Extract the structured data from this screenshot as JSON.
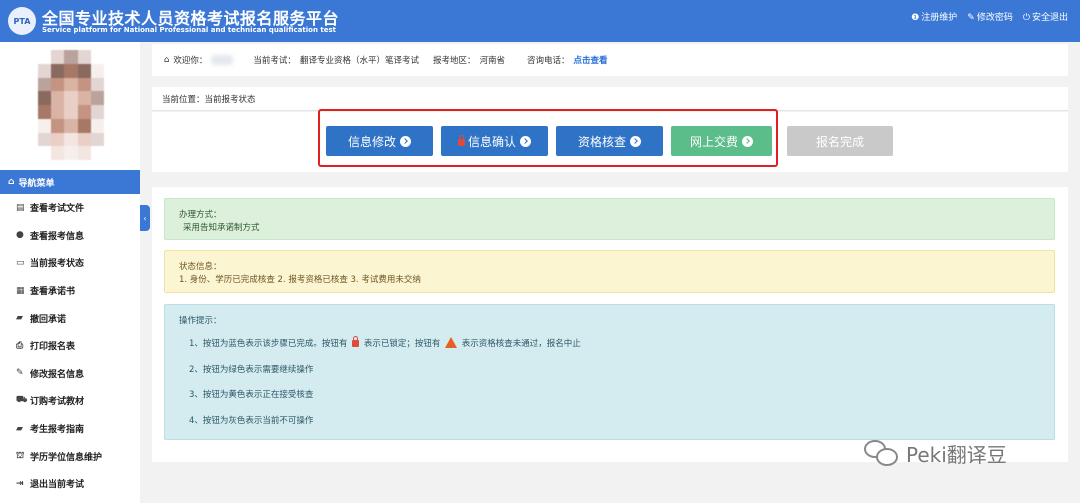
{
  "colors": {
    "header": "#3b78d6",
    "step_blue": "#2f73c6",
    "step_green": "#5bbd8a",
    "step_grey": "#c9c9c9",
    "highlight": "#e02020"
  },
  "header": {
    "title_cn": "全国专业技术人员资格考试报名服务平台",
    "title_en": "Service platform for National Professional and technican qualification test",
    "logo_text": "PTA",
    "links": [
      {
        "icon": "info-icon",
        "label": "注册维护"
      },
      {
        "icon": "edit-icon",
        "label": "修改密码"
      },
      {
        "icon": "power-icon",
        "label": "安全退出"
      }
    ]
  },
  "sidebar": {
    "nav_title": "导航菜单",
    "items": [
      {
        "icon": "document-icon",
        "label": "查看考试文件"
      },
      {
        "icon": "info-icon",
        "label": "查看报考信息"
      },
      {
        "icon": "monitor-icon",
        "label": "当前报考状态"
      },
      {
        "icon": "card-icon",
        "label": "查看承诺书"
      },
      {
        "icon": "book-icon",
        "label": "撤回承诺"
      },
      {
        "icon": "printer-icon",
        "label": "打印报名表"
      },
      {
        "icon": "edit-icon",
        "label": "修改报名信息"
      },
      {
        "icon": "cart-icon",
        "label": "订购考试教材"
      },
      {
        "icon": "book-icon",
        "label": "考生报考指南"
      },
      {
        "icon": "graduation-cap-icon",
        "label": "学历学位信息维护"
      },
      {
        "icon": "sign-out-icon",
        "label": "退出当前考试"
      }
    ]
  },
  "infobar": {
    "welcome": "欢迎你：",
    "exam_label": "当前考试：",
    "exam_value": "翻译专业资格（水平）笔译考试",
    "region_label": "报考地区：",
    "region_value": "河南省",
    "phone_label": "咨询电话：",
    "phone_link": "点击查看"
  },
  "location": "当前位置：当前报考状态",
  "steps": [
    {
      "label": "信息修改",
      "status": "blue",
      "locked": false
    },
    {
      "label": "信息确认",
      "status": "blue",
      "locked": true
    },
    {
      "label": "资格核查",
      "status": "blue",
      "locked": false
    },
    {
      "label": "网上交费",
      "status": "green",
      "locked": false
    },
    {
      "label": "报名完成",
      "status": "grey",
      "locked": false
    }
  ],
  "method": {
    "title": "办理方式：",
    "value": "采用告知承诺制方式"
  },
  "status": {
    "title": "状态信息：",
    "value": "1. 身份、学历已完成核查 2. 报考资格已核查 3. 考试费用未交纳"
  },
  "tips": {
    "title": "操作提示：",
    "line1_a": "1、按钮为蓝色表示该步骤已完成。按钮有",
    "line1_b": "表示已锁定；按钮有",
    "line1_c": "表示资格核查未通过，报名中止",
    "line2": "2、按钮为绿色表示需要继续操作",
    "line3": "3、按钮为黄色表示正在接受核查",
    "line4": "4、按钮为灰色表示当前不可操作"
  },
  "watermark": "Peki翻译豆"
}
